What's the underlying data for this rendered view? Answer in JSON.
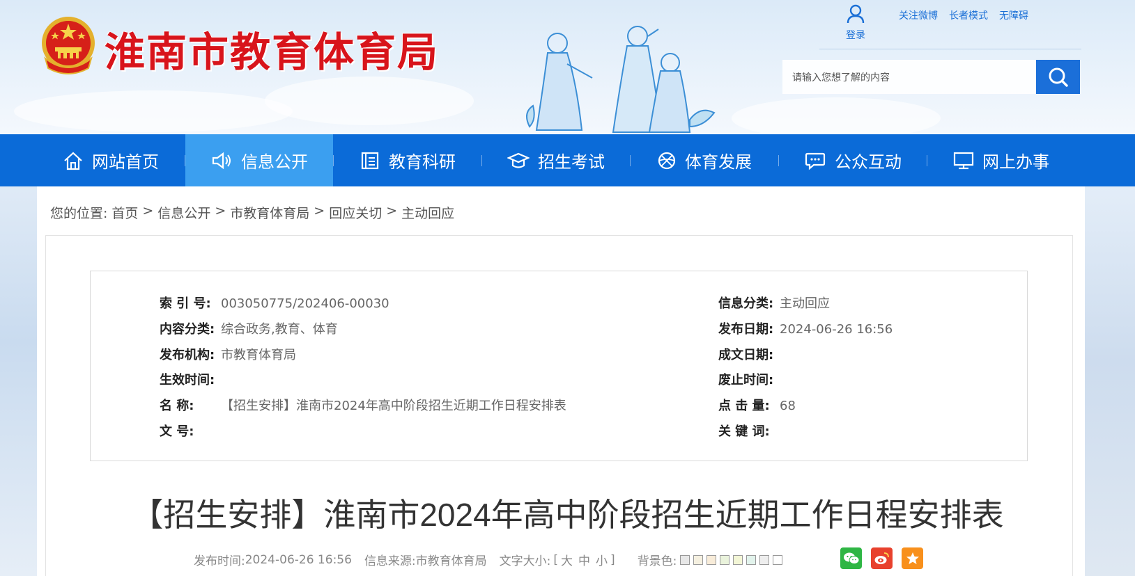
{
  "header": {
    "site_title": "淮南市教育体育局",
    "login_label": "登录",
    "top_links": [
      "关注微博",
      "长者模式",
      "无障碍"
    ],
    "search_placeholder": "请输入您想了解的内容"
  },
  "nav": {
    "items": [
      {
        "label": "网站首页",
        "icon": "home-icon"
      },
      {
        "label": "信息公开",
        "icon": "speaker-icon",
        "active": true
      },
      {
        "label": "教育科研",
        "icon": "book-icon"
      },
      {
        "label": "招生考试",
        "icon": "graduation-cap-icon"
      },
      {
        "label": "体育发展",
        "icon": "ball-icon"
      },
      {
        "label": "公众互动",
        "icon": "chat-icon"
      },
      {
        "label": "网上办事",
        "icon": "monitor-icon"
      }
    ]
  },
  "breadcrumb": {
    "prefix": "您的位置:",
    "items": [
      "首页",
      "信息公开",
      "市教育体育局",
      "回应关切",
      "主动回应"
    ],
    "separator": ">"
  },
  "meta": {
    "index_label": "索 引 号:",
    "index_value": "003050775/202406-00030",
    "category_label": "信息分类:",
    "category_value": "主动回应",
    "content_label": "内容分类:",
    "content_value": "综合政务,教育、体育",
    "pubdate_label": "发布日期:",
    "pubdate_value": "2024-06-26 16:56",
    "org_label": "发布机构:",
    "org_value": "市教育体育局",
    "docdate_label": "成文日期:",
    "docdate_value": "",
    "effective_label": "生效时间:",
    "effective_value": "",
    "expire_label": "废止时间:",
    "expire_value": "",
    "name_label": "名 称:",
    "name_value": "【招生安排】淮南市2024年高中阶段招生近期工作日程安排表",
    "clicks_label": "点 击 量:",
    "clicks_value": "68",
    "docno_label": "文 号:",
    "docno_value": "",
    "keywords_label": "关 键 词:",
    "keywords_value": ""
  },
  "article": {
    "title": "【招生安排】淮南市2024年高中阶段招生近期工作日程安排表",
    "publish_time_label": "发布时间:",
    "publish_time": "2024-06-26 16:56",
    "source_label": "信息来源:",
    "source": "市教育体育局",
    "font_size_label": "文字大小:",
    "font_sizes": [
      "大",
      "中",
      "小"
    ],
    "bracket_open": "[",
    "bracket_close": "]",
    "bg_color_label": "背景色:",
    "bg_colors": [
      "#e8e8e8",
      "#f5f0e0",
      "#f8ecd9",
      "#eaf3dc",
      "#f3f6d6",
      "#e2f3ec",
      "#eeeeee",
      "#ffffff"
    ]
  },
  "colors": {
    "brand_red": "#d8141b",
    "nav_blue": "#0b6bd8",
    "nav_active": "#3b9ff0",
    "wechat": "#2fb644",
    "weibo": "#e8412d",
    "favorite": "#f8901c"
  }
}
